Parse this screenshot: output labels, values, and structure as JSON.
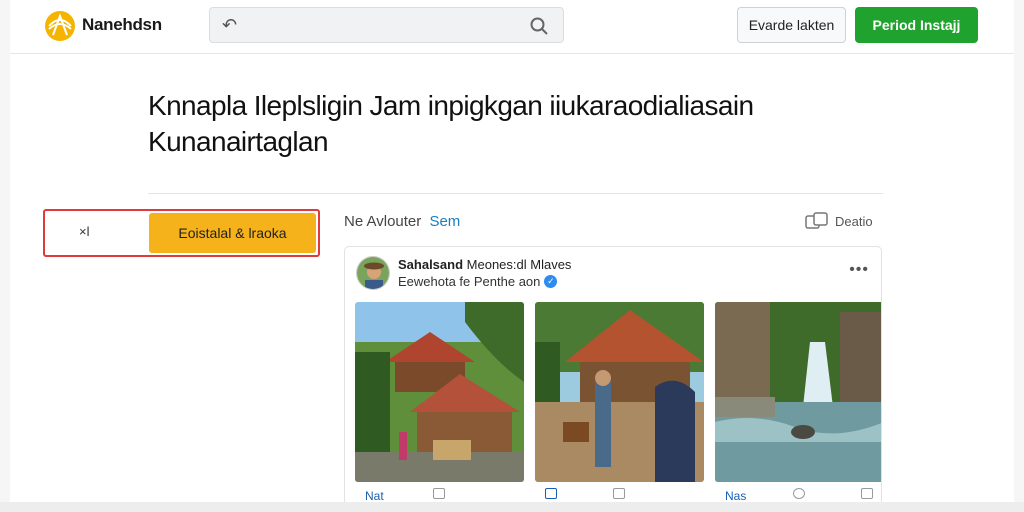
{
  "header": {
    "brand": "Nanehdsn",
    "search_back": "↶",
    "secondary_button": "Evarde lakten",
    "primary_button": "Period Instajj"
  },
  "headline": {
    "line1": "Knnapla Ileplsligin Jam inpigkgan iiukaraodialiasain",
    "line2": "Kunanairtaglan"
  },
  "action": {
    "close_label": "×l",
    "yellow_button": "Eoistalal & lraoka"
  },
  "feed": {
    "title": "Ne Avlouter",
    "see_link": "Sem",
    "right_label": "Deatio"
  },
  "post": {
    "author_name": "Sahalsand",
    "author_meta": "Meones:dl Mlaves",
    "subtitle": "Eewehota fe Penthe aon",
    "more": "•••",
    "tiles": [
      {
        "label": "Nat"
      },
      {
        "label": ""
      },
      {
        "label": "Nas"
      }
    ]
  },
  "colors": {
    "accent_green": "#1fa22e",
    "accent_yellow": "#f5b21b",
    "highlight_red": "#e03a3a",
    "link_blue": "#1a7fc1"
  },
  "icons": [
    "logo-icon",
    "back-arrow-icon",
    "search-icon",
    "copy-icon",
    "verified-icon",
    "more-icon"
  ]
}
